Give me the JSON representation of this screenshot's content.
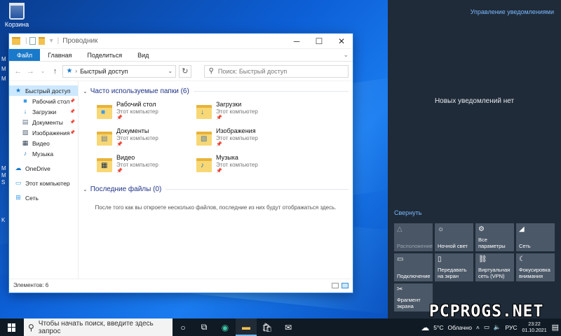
{
  "desktop": {
    "recycle_bin": "Корзина",
    "edge_letters": [
      "M",
      "M",
      "M",
      "M",
      "M",
      "S",
      "K"
    ]
  },
  "explorer": {
    "title": "Проводник",
    "ribbon_tabs": [
      "Файл",
      "Главная",
      "Поделиться",
      "Вид"
    ],
    "address": "Быстрый доступ",
    "search_placeholder": "Поиск: Быстрый доступ",
    "nav": [
      {
        "label": "Быстрый доступ",
        "icon": "star-icon",
        "glyph": "★",
        "color": "#1979ca",
        "sub": false,
        "pinned": false,
        "selected": true
      },
      {
        "label": "Рабочий стол",
        "icon": "desktop-folder-icon",
        "glyph": "■",
        "color": "#3a9be8",
        "sub": true,
        "pinned": true,
        "selected": false
      },
      {
        "label": "Загрузки",
        "icon": "download-icon",
        "glyph": "↓",
        "color": "#1979ca",
        "sub": true,
        "pinned": true,
        "selected": false
      },
      {
        "label": "Документы",
        "icon": "document-icon",
        "glyph": "▤",
        "color": "#667788",
        "sub": true,
        "pinned": true,
        "selected": false
      },
      {
        "label": "Изображения",
        "icon": "pictures-icon",
        "glyph": "▧",
        "color": "#556677",
        "sub": true,
        "pinned": true,
        "selected": false
      },
      {
        "label": "Видео",
        "icon": "video-icon",
        "glyph": "▦",
        "color": "#334455",
        "sub": true,
        "pinned": false,
        "selected": false
      },
      {
        "label": "Музыка",
        "icon": "music-icon",
        "glyph": "♪",
        "color": "#1979ca",
        "sub": true,
        "pinned": false,
        "selected": false
      },
      {
        "label": "OneDrive",
        "icon": "cloud-icon",
        "glyph": "☁",
        "color": "#1979ca",
        "sub": false,
        "pinned": false,
        "selected": false,
        "gap": true
      },
      {
        "label": "Этот компьютер",
        "icon": "computer-icon",
        "glyph": "▭",
        "color": "#3a9be8",
        "sub": false,
        "pinned": false,
        "selected": false,
        "gap": true
      },
      {
        "label": "Сеть",
        "icon": "network-icon",
        "glyph": "⊞",
        "color": "#3a9be8",
        "sub": false,
        "pinned": false,
        "selected": false,
        "gap": true
      }
    ],
    "frequent_header": "Часто используемые папки (6)",
    "folders": [
      {
        "name": "Рабочий стол",
        "location": "Этот компьютер",
        "icon": "desktop-folder-icon",
        "overlay": "■",
        "overlay_color": "#3a9be8"
      },
      {
        "name": "Загрузки",
        "location": "Этот компьютер",
        "icon": "download-folder-icon",
        "overlay": "↓",
        "overlay_color": "#1979ca"
      },
      {
        "name": "Документы",
        "location": "Этот компьютер",
        "icon": "documents-folder-icon",
        "overlay": "▤",
        "overlay_color": "#667788"
      },
      {
        "name": "Изображения",
        "location": "Этот компьютер",
        "icon": "pictures-folder-icon",
        "overlay": "▧",
        "overlay_color": "#4b7aa8"
      },
      {
        "name": "Видео",
        "location": "Этот компьютер",
        "icon": "video-folder-icon",
        "overlay": "▦",
        "overlay_color": "#223344"
      },
      {
        "name": "Музыка",
        "location": "Этот компьютер",
        "icon": "music-folder-icon",
        "overlay": "♪",
        "overlay_color": "#1979ca"
      }
    ],
    "pin_glyph": "📌",
    "recent_header": "Последние файлы (0)",
    "recent_empty": "После того как вы откроете несколько файлов, последние из них будут отображаться здесь.",
    "status": "Элементов: 6"
  },
  "action_center": {
    "manage": "Управление уведомлениями",
    "no_notifications": "Новых уведомлений нет",
    "collapse": "Свернуть",
    "tiles": [
      {
        "label": "Расположение",
        "icon": "location-icon",
        "glyph": "△",
        "dim": true
      },
      {
        "label": "Ночной свет",
        "icon": "brightness-icon",
        "glyph": "☼",
        "dim": false
      },
      {
        "label": "Все параметры",
        "icon": "gear-icon",
        "glyph": "⚙",
        "dim": false
      },
      {
        "label": "Сеть",
        "icon": "network-icon",
        "glyph": "◢",
        "dim": false
      },
      {
        "label": "Подключение",
        "icon": "connect-icon",
        "glyph": "▭",
        "dim": false
      },
      {
        "label": "Передавать на экран",
        "icon": "project-icon",
        "glyph": "▯",
        "dim": false
      },
      {
        "label": "Виртуальная сеть (VPN)",
        "icon": "vpn-icon",
        "glyph": "⛓",
        "dim": false
      },
      {
        "label": "Фокусировка внимания",
        "icon": "moon-icon",
        "glyph": "☾",
        "dim": false
      },
      {
        "label": "Фрагмент экрана",
        "icon": "snip-icon",
        "glyph": "✂",
        "dim": false
      }
    ]
  },
  "taskbar": {
    "search_placeholder": "Чтобы начать поиск, введите здесь запрос",
    "weather_temp": "5°C",
    "weather_text": "Облачно",
    "language": "РУС",
    "time": "23:22",
    "date": "01.10.2021"
  },
  "watermark": "PCPROGS.NET"
}
